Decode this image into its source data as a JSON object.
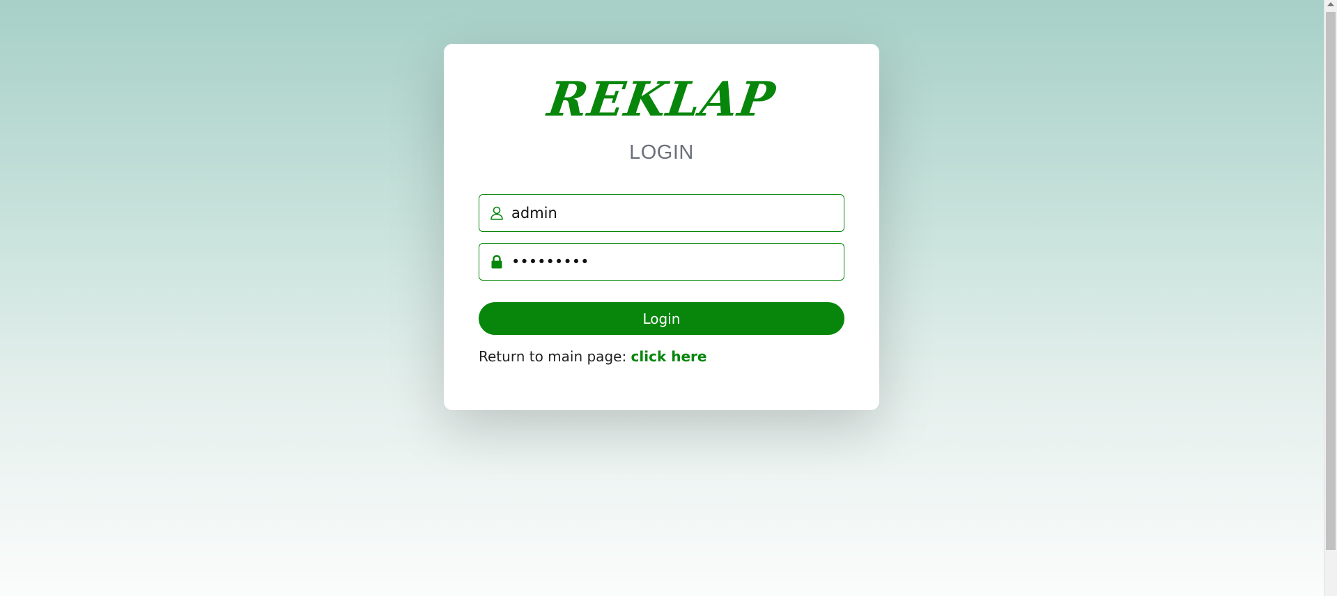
{
  "brand": {
    "logo_text": "REKLAP",
    "color": "#07860b"
  },
  "form": {
    "heading": "LOGIN",
    "username": {
      "value": "admin",
      "icon": "user-icon"
    },
    "password": {
      "value": "•••••••••",
      "icon": "lock-icon"
    },
    "submit_label": "Login"
  },
  "footer": {
    "return_text": "Return to main page:",
    "link_text": "click here"
  },
  "colors": {
    "accent": "#07860b",
    "heading": "#6b6f78",
    "background_top": "#a7d0c8",
    "background_bottom": "#fbfcfc"
  }
}
